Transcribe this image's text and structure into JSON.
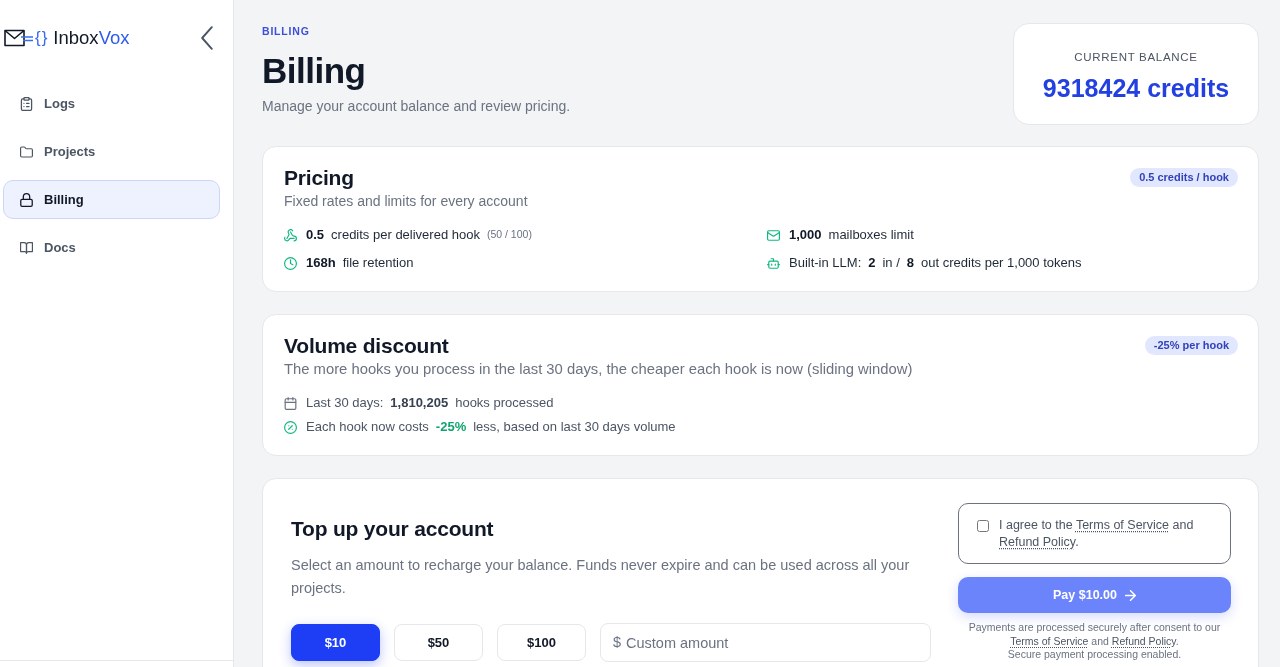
{
  "sidebar": {
    "logo": {
      "mark": "{}",
      "name": "Inbox",
      "name_accent": "Vox"
    },
    "items": [
      {
        "label": "Logs",
        "selected": false
      },
      {
        "label": "Projects",
        "selected": false
      },
      {
        "label": "Billing",
        "selected": true
      },
      {
        "label": "Docs",
        "selected": false
      }
    ]
  },
  "header": {
    "eyebrow": "BILLING",
    "title": "Billing",
    "subtitle": "Manage your account balance and review pricing."
  },
  "balance": {
    "label": "CURRENT BALANCE",
    "value": "9318424 credits"
  },
  "pricing": {
    "title": "Pricing",
    "subtitle": "Fixed rates and limits for every account",
    "badge": "0.5 credits / hook",
    "items": [
      {
        "parts": [
          {
            "text": "0.5",
            "kind": "value"
          },
          {
            "text": "credits per delivered hook",
            "kind": "label"
          },
          {
            "text": "(50 / 100)",
            "kind": "note"
          }
        ]
      },
      {
        "parts": [
          {
            "text": "1,000",
            "kind": "value"
          },
          {
            "text": "mailboxes limit",
            "kind": "label"
          }
        ]
      },
      {
        "parts": [
          {
            "text": "168h",
            "kind": "value"
          },
          {
            "text": "file retention",
            "kind": "label"
          }
        ]
      },
      {
        "parts": [
          {
            "text": "Built-in LLM:",
            "kind": "label"
          },
          {
            "text": "2",
            "kind": "value"
          },
          {
            "text": "in /",
            "kind": "label"
          },
          {
            "text": "8",
            "kind": "value"
          },
          {
            "text": "out credits per 1,000 tokens",
            "kind": "label"
          }
        ]
      }
    ]
  },
  "volume": {
    "title": "Volume discount",
    "subtitle": "The more hooks you process in the last 30 days, the cheaper each hook is now (sliding window)",
    "badge": "-25% per hook",
    "items": [
      {
        "parts": [
          {
            "text": "Last 30 days:",
            "kind": "label"
          },
          {
            "text": "1,810,205",
            "kind": "value"
          },
          {
            "text": "hooks processed",
            "kind": "label"
          }
        ]
      },
      {
        "parts": [
          {
            "text": "Each hook now costs",
            "kind": "label"
          },
          {
            "text": "-25%",
            "kind": "accent"
          },
          {
            "text": "less, based on last 30 days volume",
            "kind": "label"
          }
        ]
      }
    ]
  },
  "topup": {
    "title": "Top up your account",
    "description": "Select an amount to recharge your balance. Funds never expire and can be used across all your projects.",
    "amounts": [
      {
        "label": "$10",
        "selected": true
      },
      {
        "label": "$50",
        "selected": false
      },
      {
        "label": "$100",
        "selected": false
      }
    ],
    "custom": {
      "prefix": "$",
      "placeholder": "Custom amount"
    },
    "agreement": {
      "checked": false,
      "parts": [
        {
          "text": "I agree to the ",
          "kind": "text"
        },
        {
          "text": "Terms of Service",
          "kind": "link"
        },
        {
          "text": " and ",
          "kind": "text"
        },
        {
          "text": "Refund Policy",
          "kind": "link"
        },
        {
          "text": ".",
          "kind": "text"
        }
      ]
    },
    "pay_button": {
      "label": "Pay $10.00",
      "disabled": true
    },
    "notes": [
      {
        "parts": [
          {
            "text": "Payments are processed securely after consent to our ",
            "kind": "text"
          },
          {
            "text": "Terms of Service",
            "kind": "link"
          },
          {
            "text": " and ",
            "kind": "text"
          },
          {
            "text": "Refund Policy",
            "kind": "link"
          },
          {
            "text": ".",
            "kind": "text"
          }
        ]
      },
      {
        "parts": [
          {
            "text": "Secure payment processing enabled.",
            "kind": "text"
          }
        ]
      }
    ]
  }
}
